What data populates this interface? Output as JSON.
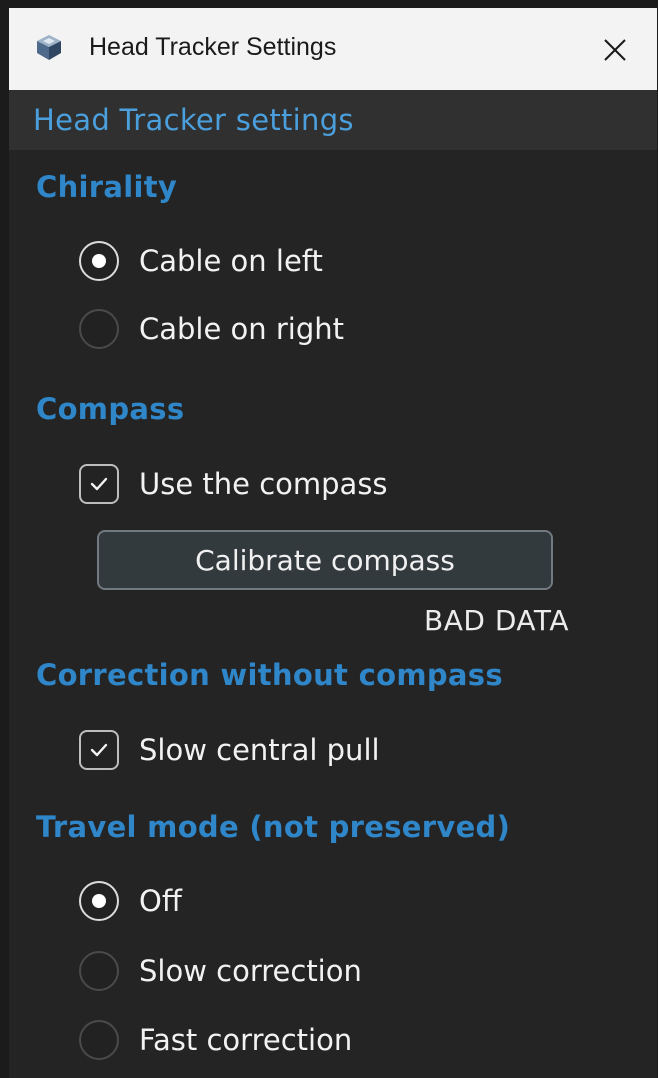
{
  "window": {
    "title": "Head Tracker Settings",
    "app_icon": "cube-icon",
    "close_icon": "close-icon"
  },
  "header": {
    "title": "Head Tracker settings"
  },
  "chirality": {
    "title": "Chirality",
    "options": [
      {
        "label": "Cable on left",
        "selected": true
      },
      {
        "label": "Cable on right",
        "selected": false
      }
    ]
  },
  "compass": {
    "title": "Compass",
    "use_label": "Use the compass",
    "use_checked": true,
    "calibrate_label": "Calibrate compass",
    "status": "BAD DATA"
  },
  "correction": {
    "title": "Correction without compass",
    "slow_pull_label": "Slow central pull",
    "slow_pull_checked": true
  },
  "travel": {
    "title": "Travel mode (not preserved)",
    "options": [
      {
        "label": "Off",
        "selected": true
      },
      {
        "label": "Slow correction",
        "selected": false
      },
      {
        "label": "Fast correction",
        "selected": false
      }
    ]
  },
  "colors": {
    "accent": "#2f86c9",
    "header_accent": "#4a9fdc",
    "background": "#242424",
    "titlebar": "#f3f3f3"
  }
}
